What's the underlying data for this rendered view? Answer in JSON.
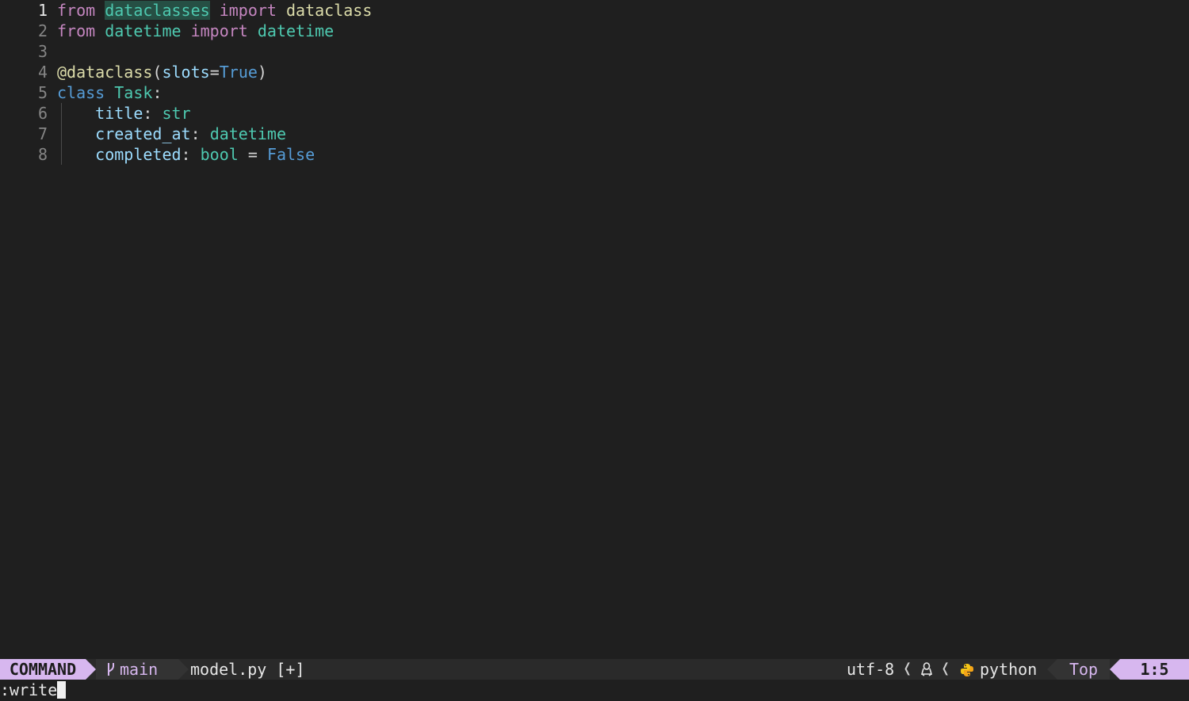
{
  "editor": {
    "lines": [
      {
        "num": "1",
        "tokens": [
          {
            "text": "from",
            "cls": "kw"
          },
          {
            "text": " ",
            "cls": "plain"
          },
          {
            "text": "dataclasses",
            "cls": "cls hl"
          },
          {
            "text": " ",
            "cls": "plain"
          },
          {
            "text": "import",
            "cls": "kw"
          },
          {
            "text": " ",
            "cls": "plain"
          },
          {
            "text": "dataclass",
            "cls": "fn"
          }
        ]
      },
      {
        "num": "2",
        "tokens": [
          {
            "text": "from",
            "cls": "kw"
          },
          {
            "text": " ",
            "cls": "plain"
          },
          {
            "text": "datetime",
            "cls": "cls"
          },
          {
            "text": " ",
            "cls": "plain"
          },
          {
            "text": "import",
            "cls": "kw"
          },
          {
            "text": " ",
            "cls": "plain"
          },
          {
            "text": "datetime",
            "cls": "cls"
          }
        ]
      },
      {
        "num": "3",
        "tokens": []
      },
      {
        "num": "4",
        "tokens": [
          {
            "text": "@dataclass",
            "cls": "fn"
          },
          {
            "text": "(",
            "cls": "plain"
          },
          {
            "text": "slots",
            "cls": "prop"
          },
          {
            "text": "=",
            "cls": "op"
          },
          {
            "text": "True",
            "cls": "const"
          },
          {
            "text": ")",
            "cls": "plain"
          }
        ]
      },
      {
        "num": "5",
        "tokens": [
          {
            "text": "class",
            "cls": "const"
          },
          {
            "text": " ",
            "cls": "plain"
          },
          {
            "text": "Task",
            "cls": "cls"
          },
          {
            "text": ":",
            "cls": "plain"
          }
        ]
      },
      {
        "num": "6",
        "tokens": [
          {
            "text": "    ",
            "cls": "plain"
          },
          {
            "text": "title",
            "cls": "prop"
          },
          {
            "text": ": ",
            "cls": "plain"
          },
          {
            "text": "str",
            "cls": "cls"
          }
        ]
      },
      {
        "num": "7",
        "tokens": [
          {
            "text": "    ",
            "cls": "plain"
          },
          {
            "text": "created_at",
            "cls": "prop"
          },
          {
            "text": ": ",
            "cls": "plain"
          },
          {
            "text": "datetime",
            "cls": "cls"
          }
        ]
      },
      {
        "num": "8",
        "tokens": [
          {
            "text": "    ",
            "cls": "plain"
          },
          {
            "text": "completed",
            "cls": "prop"
          },
          {
            "text": ": ",
            "cls": "plain"
          },
          {
            "text": "bool",
            "cls": "cls"
          },
          {
            "text": " = ",
            "cls": "op"
          },
          {
            "text": "False",
            "cls": "const"
          }
        ]
      }
    ]
  },
  "statusline": {
    "mode": "COMMAND",
    "branch_icon": "git-branch-icon",
    "branch": "main",
    "file": "model.py [+]",
    "encoding": "utf-8",
    "os_icon": "linux-tux-icon",
    "filetype_icon": "python-icon",
    "filetype": "python",
    "scroll": "Top",
    "position": "1:5",
    "colors": {
      "mode_bg": "#d7b7ef",
      "segment_bg": "#333333",
      "bar_bg": "#2a2a2a"
    }
  },
  "cmdline": {
    "text": ":write"
  }
}
